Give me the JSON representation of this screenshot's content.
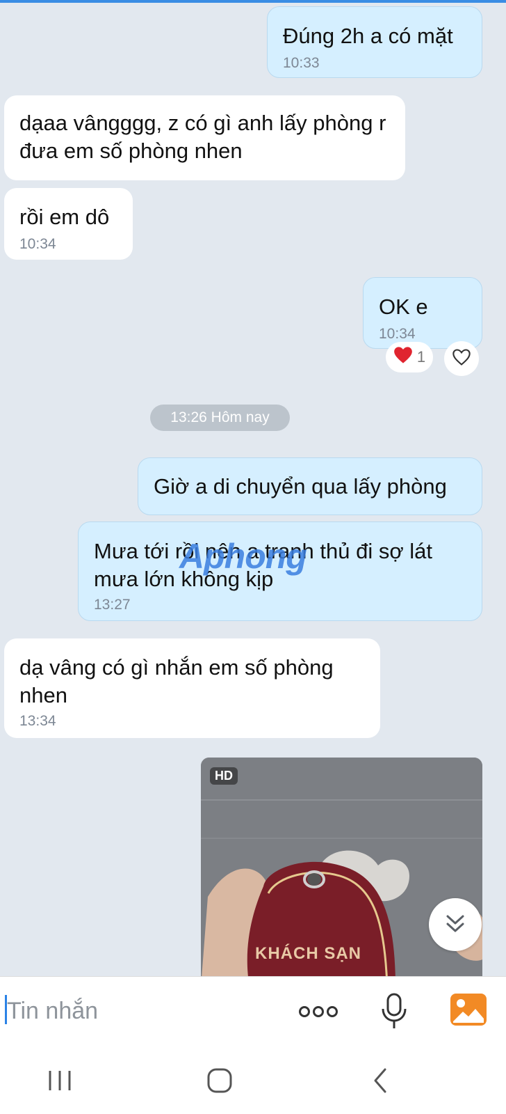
{
  "messages": [
    {
      "dir": "out",
      "text": "Đúng 2h a có mặt",
      "time": "10:33"
    },
    {
      "dir": "in",
      "text": "dạaa vângggg, z có gì anh lấy phòng r đưa em số phòng nhen"
    },
    {
      "dir": "in",
      "text": "rồi em dô",
      "time": "10:34"
    },
    {
      "dir": "out",
      "text": "OK e",
      "time": "10:34"
    },
    {
      "dir": "out",
      "text": "Giờ a di chuyển qua lấy phòng"
    },
    {
      "dir": "out",
      "text": "Mưa tới rồi nên a tranh thủ đi sợ lát mưa lớn không kịp",
      "time": "13:27"
    },
    {
      "dir": "in",
      "text": "dạ vâng có gì nhắn em số phòng nhen",
      "time": "13:34"
    }
  ],
  "reaction": {
    "count": "1"
  },
  "date_chip": "13:26 Hôm nay",
  "photo": {
    "badge": "HD",
    "key_tag_text": "KHÁCH SẠN"
  },
  "watermark": "Aphong",
  "composer": {
    "placeholder": "Tin nhắn"
  },
  "colors": {
    "outgoing_bubble": "#d5efff",
    "incoming_bubble": "#ffffff",
    "background": "#e2e8ef",
    "accent": "#2b83e6"
  }
}
